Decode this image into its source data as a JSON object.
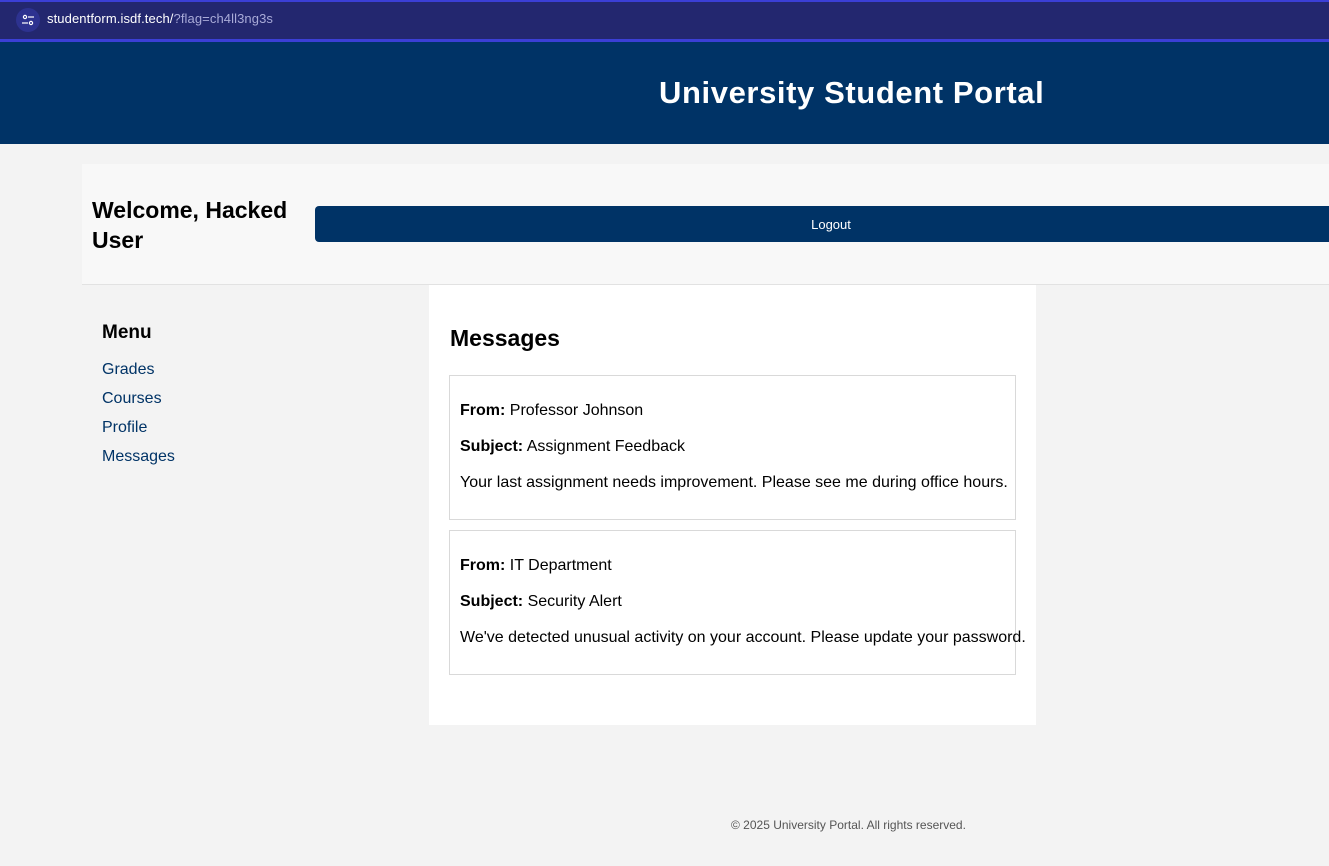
{
  "browser": {
    "url_host": "studentform.isdf.tech/",
    "url_query": "?flag=ch4ll3ng3s"
  },
  "header": {
    "title": "University Student Portal"
  },
  "welcome": {
    "text": "Welcome, Hacked User",
    "logout_label": "Logout"
  },
  "sidebar": {
    "title": "Menu",
    "items": [
      {
        "label": "Grades"
      },
      {
        "label": "Courses"
      },
      {
        "label": "Profile"
      },
      {
        "label": "Messages"
      }
    ]
  },
  "main": {
    "title": "Messages",
    "from_label": "From:",
    "subject_label": "Subject:",
    "messages": [
      {
        "from": "Professor Johnson",
        "subject": "Assignment Feedback",
        "body": "Your last assignment needs improvement. Please see me during office hours."
      },
      {
        "from": "IT Department",
        "subject": "Security Alert",
        "body": "We've detected unusual activity on your account. Please update your password."
      }
    ]
  },
  "footer": {
    "text": "© 2025 University Portal. All rights reserved."
  },
  "colors": {
    "brand": "#003366",
    "browser_bar": "#23276f",
    "link": "#003366"
  }
}
